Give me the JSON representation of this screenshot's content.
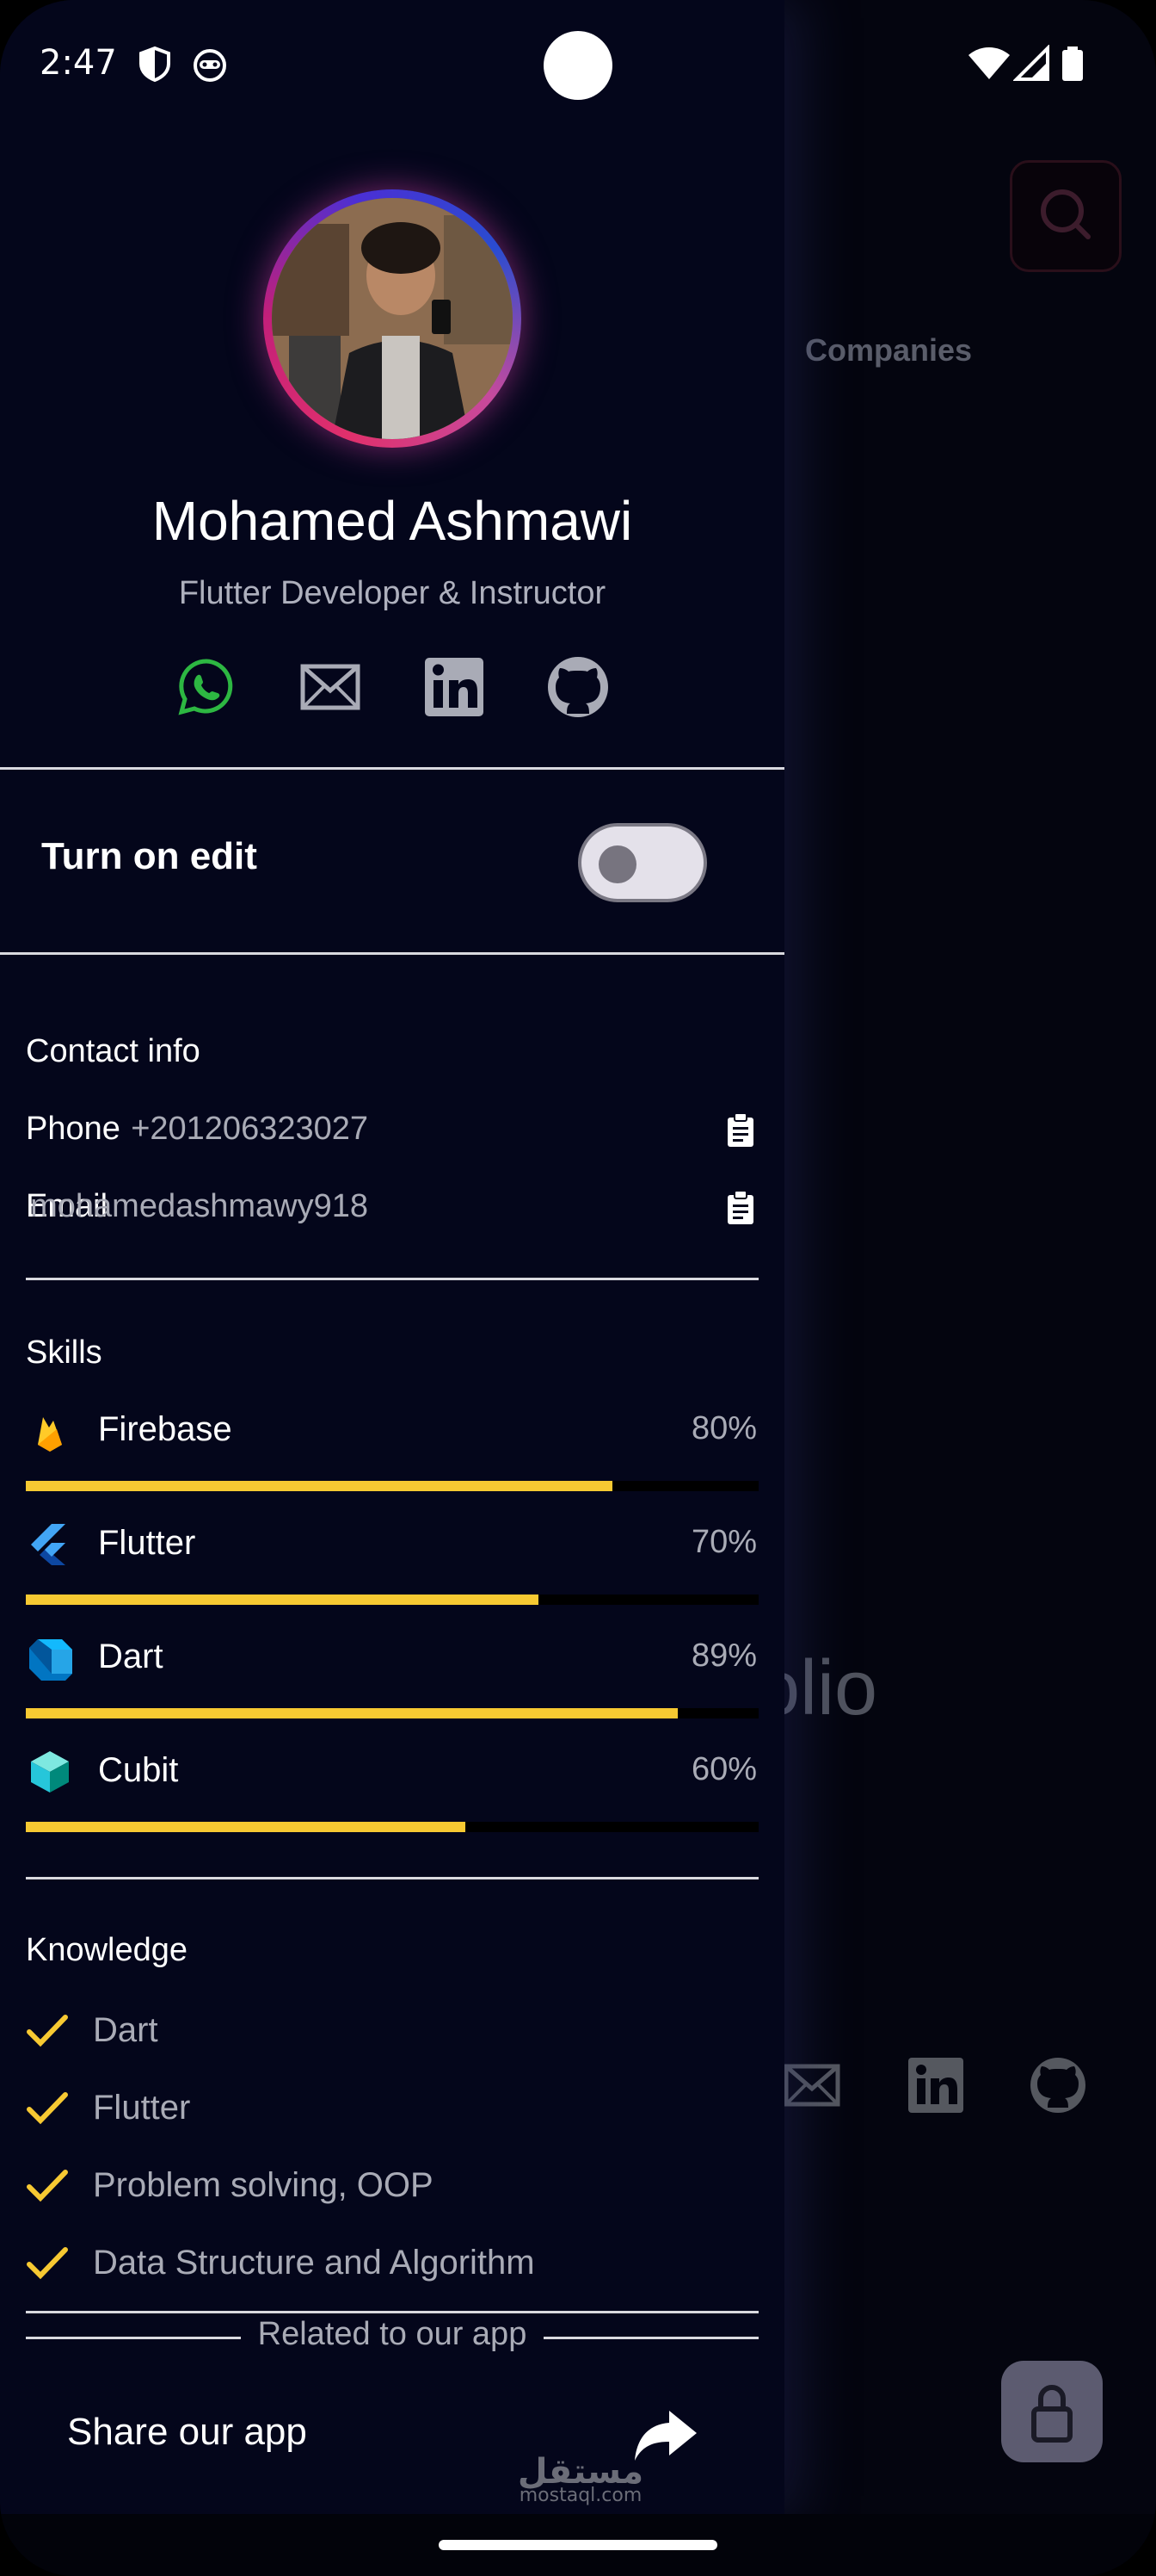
{
  "status_bar": {
    "time": "2:47"
  },
  "background": {
    "tab_label": "Companies",
    "big_text_fragment": "olio"
  },
  "drawer": {
    "name": "Mohamed Ashmawi",
    "title": "Flutter Developer & Instructor",
    "social": [
      "whatsapp-icon",
      "mail-icon",
      "linkedin-icon",
      "github-icon"
    ],
    "edit_toggle": {
      "label": "Turn on edit",
      "on": false
    },
    "contact": {
      "heading": "Contact info",
      "items": [
        {
          "label": "Phone",
          "value": "+201206323027"
        },
        {
          "label": "Email",
          "value": "mohamedashmawy918"
        }
      ]
    },
    "skills": {
      "heading": "Skills",
      "items": [
        {
          "name": "Firebase",
          "percent_label": "80%",
          "level": 0.8
        },
        {
          "name": "Flutter",
          "percent_label": "70%",
          "level": 0.7
        },
        {
          "name": "Dart",
          "percent_label": "89%",
          "level": 0.89
        },
        {
          "name": "Cubit",
          "percent_label": "60%",
          "level": 0.6
        }
      ],
      "bar_color": "#f7c932"
    },
    "knowledge": {
      "heading": "Knowledge",
      "items": [
        "Dart",
        "Flutter",
        "Problem solving, OOP",
        "Data Structure and Algorithm"
      ]
    },
    "related": {
      "divider_label": "Related to our app",
      "share_label": "Share our app"
    }
  },
  "watermark": {
    "arabic": "مستقل",
    "latin": "mostaql.com"
  },
  "colors": {
    "drawer_bg": "#04061b",
    "accent_yellow": "#f7c932",
    "whatsapp_green": "#2db742"
  }
}
